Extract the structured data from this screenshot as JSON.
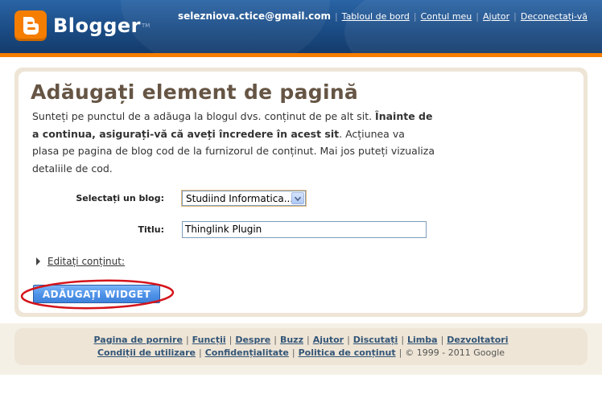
{
  "header": {
    "logo_text": "Blogger",
    "logo_tm": "TM",
    "email": "selezniova.ctice@gmail.com",
    "nav": [
      "Tabloul de bord",
      "Contul meu",
      "Ajutor",
      "Deconectați-vă"
    ]
  },
  "main": {
    "title": "Adăugați element de pagină",
    "desc_part1": "Sunteți pe punctul de a adăuga la blogul dvs. conținut de pe alt sit. ",
    "desc_bold": "Înainte de a continua, asigurați-vă că aveți încredere în acest sit",
    "desc_part2": ". Acțiunea va plasa pe pagina de blog cod de la furnizorul de conținut. Mai jos puteți vizualiza detaliile de cod.",
    "blog_label": "Selectați un blog:",
    "blog_value": "Studiind Informatica...",
    "title_label": "Titlu:",
    "title_value": "Thinglink Plugin",
    "edit_link": "Editați conținut:",
    "add_button": "ADĂUGAȚI WIDGET",
    "highlight_color": "#d4141b"
  },
  "footer": {
    "row1": [
      "Pagina de pornire",
      "Funcții",
      "Despre",
      "Buzz",
      "Ajutor",
      "Discutați",
      "Limba",
      "Dezvoltatori"
    ],
    "row2": [
      "Condiții de utilizare",
      "Confidențialitate",
      "Politica de conținut"
    ],
    "copyright": "© 1999 - 2011 Google"
  },
  "colors": {
    "header_blue": "#1d4f87",
    "brand_orange": "#f57d00",
    "panel_beige": "#eee5d6",
    "button_blue": "#4d91e8"
  }
}
